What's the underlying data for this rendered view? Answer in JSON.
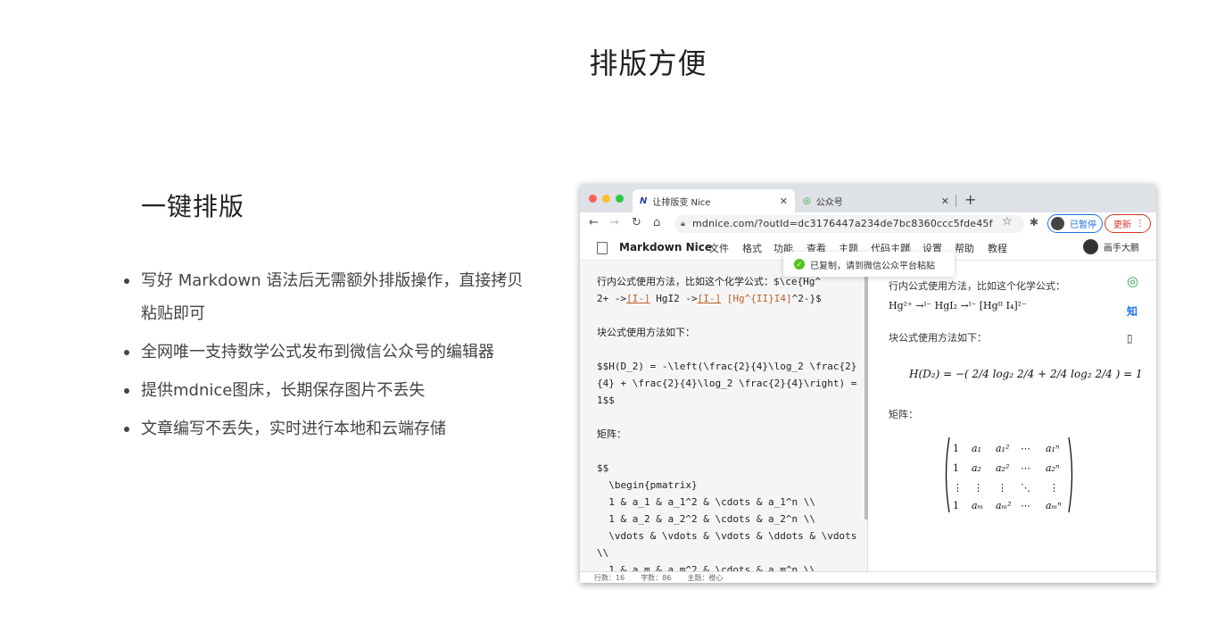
{
  "page": {
    "title": "排版方便"
  },
  "feature": {
    "heading": "一键排版",
    "bullets": [
      "写好 Markdown 语法后无需额外排版操作，直接拷贝粘贴即可",
      "全网唯一支持数学公式发布到微信公众号的编辑器",
      "提供mdnice图床，长期保存图片不丢失",
      "文章编写不丢失，实时进行本地和云端存储"
    ]
  },
  "browser": {
    "tabs": [
      {
        "icon": "N",
        "label": "让排版变 Nice"
      },
      {
        "icon": "◎",
        "label": "公众号"
      }
    ],
    "url": "mdnice.com/?outId=dc3176447a234de7bc8360ccc5fde45f",
    "paused_label": "已暂停",
    "update_label": "更新",
    "app_name": "Markdown Nice",
    "menu": [
      "文件",
      "格式",
      "功能",
      "查看",
      "主题",
      "代码主题",
      "设置",
      "帮助",
      "教程"
    ],
    "user_name": "画手大鹏",
    "toast": "已复制，请到微信公众平台粘贴",
    "editor": {
      "line1": "行内公式使用方法，比如这个化学公式：$\\ce{Hg^",
      "line2_a": "2+ ->",
      "line2_b": "[I-]",
      "line2_c": " HgI2 ->",
      "line2_d": "[I-]",
      "line2_e": " [Hg^{II}I4]",
      "line2_f": "^2-}$",
      "rest": "\n块公式使用方法如下：\n\n$$H(D_2) = -\\left(\\frac{2}{4}\\log_2 \\frac{2}{4} + \\frac{2}{4}\\log_2 \\frac{2}{4}\\right) = 1$$\n\n矩阵：\n\n$$\n  \\begin{pmatrix}\n  1 & a_1 & a_1^2 & \\cdots & a_1^n \\\\\n  1 & a_2 & a_2^2 & \\cdots & a_2^n \\\\\n  \\vdots & \\vdots & \\vdots & \\ddots & \\vdots \\\\\n  1 & a_m & a_m^2 & \\cdots & a_m^n \\\\"
    },
    "preview": {
      "p1": "行内公式使用方法，比如这个化学公式：",
      "chem": "Hg²⁺ →ᴵ⁻ HgI₂ →ᴵ⁻ [Hgᴵᴵ I₄]²⁻",
      "p2": "块公式使用方法如下：",
      "formula": "H(D₂) = −( 2/4 log₂ 2/4 + 2/4 log₂ 2/4 ) = 1",
      "p3": "矩阵："
    },
    "side_icons": [
      "wechat-icon",
      "zhihu-icon",
      "phone-icon"
    ],
    "side_labels": {
      "zhihu": "知"
    },
    "status": [
      "行数：16",
      "字数：86",
      "主题：橙心"
    ]
  }
}
